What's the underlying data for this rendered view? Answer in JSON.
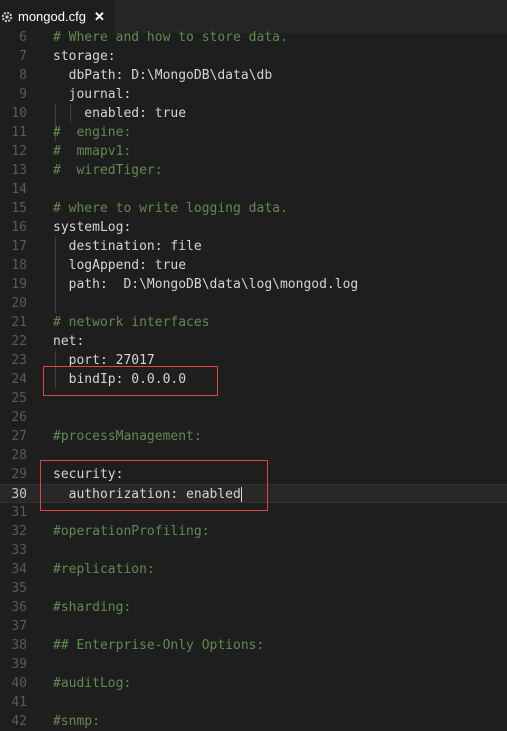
{
  "tab": {
    "title": "mongod.cfg",
    "close": "✕"
  },
  "lines": [
    {
      "n": "6",
      "text": "# Where and how to store data.",
      "comment": true
    },
    {
      "n": "7",
      "text": "storage:",
      "comment": false
    },
    {
      "n": "8",
      "text": "  dbPath: D:\\MongoDB\\data\\db",
      "comment": false
    },
    {
      "n": "9",
      "text": "  journal:",
      "comment": false
    },
    {
      "n": "10",
      "text": "    enabled: true",
      "comment": false
    },
    {
      "n": "11",
      "text": "#  engine:",
      "comment": true
    },
    {
      "n": "12",
      "text": "#  mmapv1:",
      "comment": true
    },
    {
      "n": "13",
      "text": "#  wiredTiger:",
      "comment": true
    },
    {
      "n": "14",
      "text": "",
      "comment": false
    },
    {
      "n": "15",
      "text": "# where to write logging data.",
      "comment": true
    },
    {
      "n": "16",
      "text": "systemLog:",
      "comment": false
    },
    {
      "n": "17",
      "text": "  destination: file",
      "comment": false
    },
    {
      "n": "18",
      "text": "  logAppend: true",
      "comment": false
    },
    {
      "n": "19",
      "text": "  path:  D:\\MongoDB\\data\\log\\mongod.log",
      "comment": false
    },
    {
      "n": "20",
      "text": "",
      "comment": false
    },
    {
      "n": "21",
      "text": "# network interfaces",
      "comment": true
    },
    {
      "n": "22",
      "text": "net:",
      "comment": false
    },
    {
      "n": "23",
      "text": "  port: 27017",
      "comment": false
    },
    {
      "n": "24",
      "text": "  bindIp: 0.0.0.0",
      "comment": false
    },
    {
      "n": "25",
      "text": "",
      "comment": false
    },
    {
      "n": "26",
      "text": "",
      "comment": false
    },
    {
      "n": "27",
      "text": "#processManagement:",
      "comment": true
    },
    {
      "n": "28",
      "text": "",
      "comment": false
    },
    {
      "n": "29",
      "text": "security:",
      "comment": false
    },
    {
      "n": "30",
      "text": "  authorization: enabled",
      "comment": false,
      "current": true
    },
    {
      "n": "31",
      "text": "",
      "comment": false
    },
    {
      "n": "32",
      "text": "#operationProfiling:",
      "comment": true
    },
    {
      "n": "33",
      "text": "",
      "comment": false
    },
    {
      "n": "34",
      "text": "#replication:",
      "comment": true
    },
    {
      "n": "35",
      "text": "",
      "comment": false
    },
    {
      "n": "36",
      "text": "#sharding:",
      "comment": true
    },
    {
      "n": "37",
      "text": "",
      "comment": false
    },
    {
      "n": "38",
      "text": "## Enterprise-Only Options:",
      "comment": true
    },
    {
      "n": "39",
      "text": "",
      "comment": false
    },
    {
      "n": "40",
      "text": "#auditLog:",
      "comment": true
    },
    {
      "n": "41",
      "text": "",
      "comment": false
    },
    {
      "n": "42",
      "text": "#snmp:",
      "comment": true
    }
  ]
}
